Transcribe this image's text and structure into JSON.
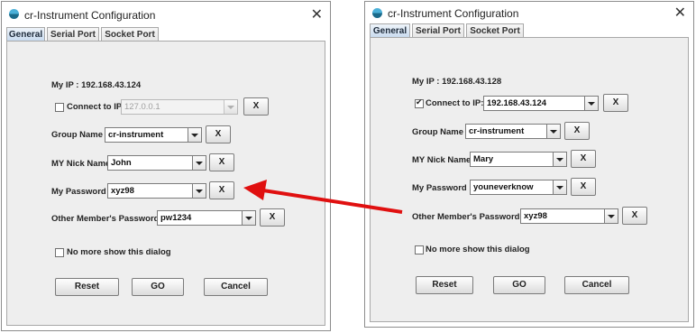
{
  "window_title": "cr-Instrument Configuration",
  "tabs": [
    "General",
    "Serial Port",
    "Socket Port"
  ],
  "close_glyph": "✕",
  "x_label": "X",
  "labels": {
    "my_ip": "My IP :",
    "connect_to_ip": "Connect to IP:",
    "group_name": "Group Name :",
    "nick_name": "MY Nick Name:",
    "password": "My Password :",
    "other_password": "Other Member's Password :",
    "no_more_show": "No more show this dialog"
  },
  "buttons": {
    "reset": "Reset",
    "go": "GO",
    "cancel": "Cancel"
  },
  "left": {
    "my_ip_value": "192.168.43.124",
    "connect_checked": false,
    "connect_ip": "127.0.0.1",
    "group_name": "cr-instrument",
    "nick_name": "John",
    "password": "xyz98",
    "other_password": "pw1234",
    "no_more_show_checked": false
  },
  "right": {
    "my_ip_value": "192.168.43.128",
    "connect_checked": true,
    "connect_ip": "192.168.43.124",
    "group_name": "cr-instrument",
    "nick_name": "Mary",
    "password": "youneverknow",
    "other_password": "xyz98",
    "no_more_show_checked": false
  },
  "arrow_color": "#e01010",
  "accent_tab_color": "#c9dbef"
}
